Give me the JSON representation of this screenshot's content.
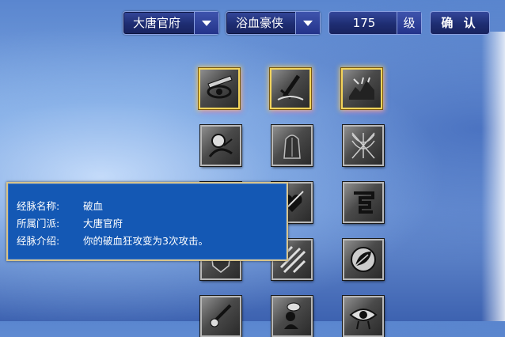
{
  "toolbar": {
    "school_select": "大唐官府",
    "branch_select": "浴血豪侠",
    "level_value": "175",
    "level_unit": "级",
    "confirm_label": "确 认"
  },
  "skills": [
    {
      "icon": "eye-blade-icon",
      "active": true
    },
    {
      "icon": "sword-strike-icon",
      "active": true
    },
    {
      "icon": "broken-ground-icon",
      "active": true
    },
    {
      "icon": "warrior-portrait-icon",
      "active": false
    },
    {
      "icon": "armored-figure-icon",
      "active": false
    },
    {
      "icon": "claw-web-icon",
      "active": false
    },
    {
      "icon": "rune-block-icon",
      "active": false
    },
    {
      "icon": "heart-arrow-icon",
      "active": false
    },
    {
      "icon": "glyph-maze-icon",
      "active": false
    },
    {
      "icon": "shield-icon",
      "active": false
    },
    {
      "icon": "slash-pattern-icon",
      "active": false
    },
    {
      "icon": "leaf-badge-icon",
      "active": false
    },
    {
      "icon": "blade-hand-icon",
      "active": false
    },
    {
      "icon": "crouching-figure-icon",
      "active": false
    },
    {
      "icon": "crying-eye-icon",
      "active": false
    }
  ],
  "tooltip": {
    "name_label": "经脉名称:",
    "name_value": "破血",
    "school_label": "所属门派:",
    "school_value": "大唐官府",
    "desc_label": "经脉介绍:",
    "desc_value": "你的破血狂攻变为3次攻击。"
  }
}
